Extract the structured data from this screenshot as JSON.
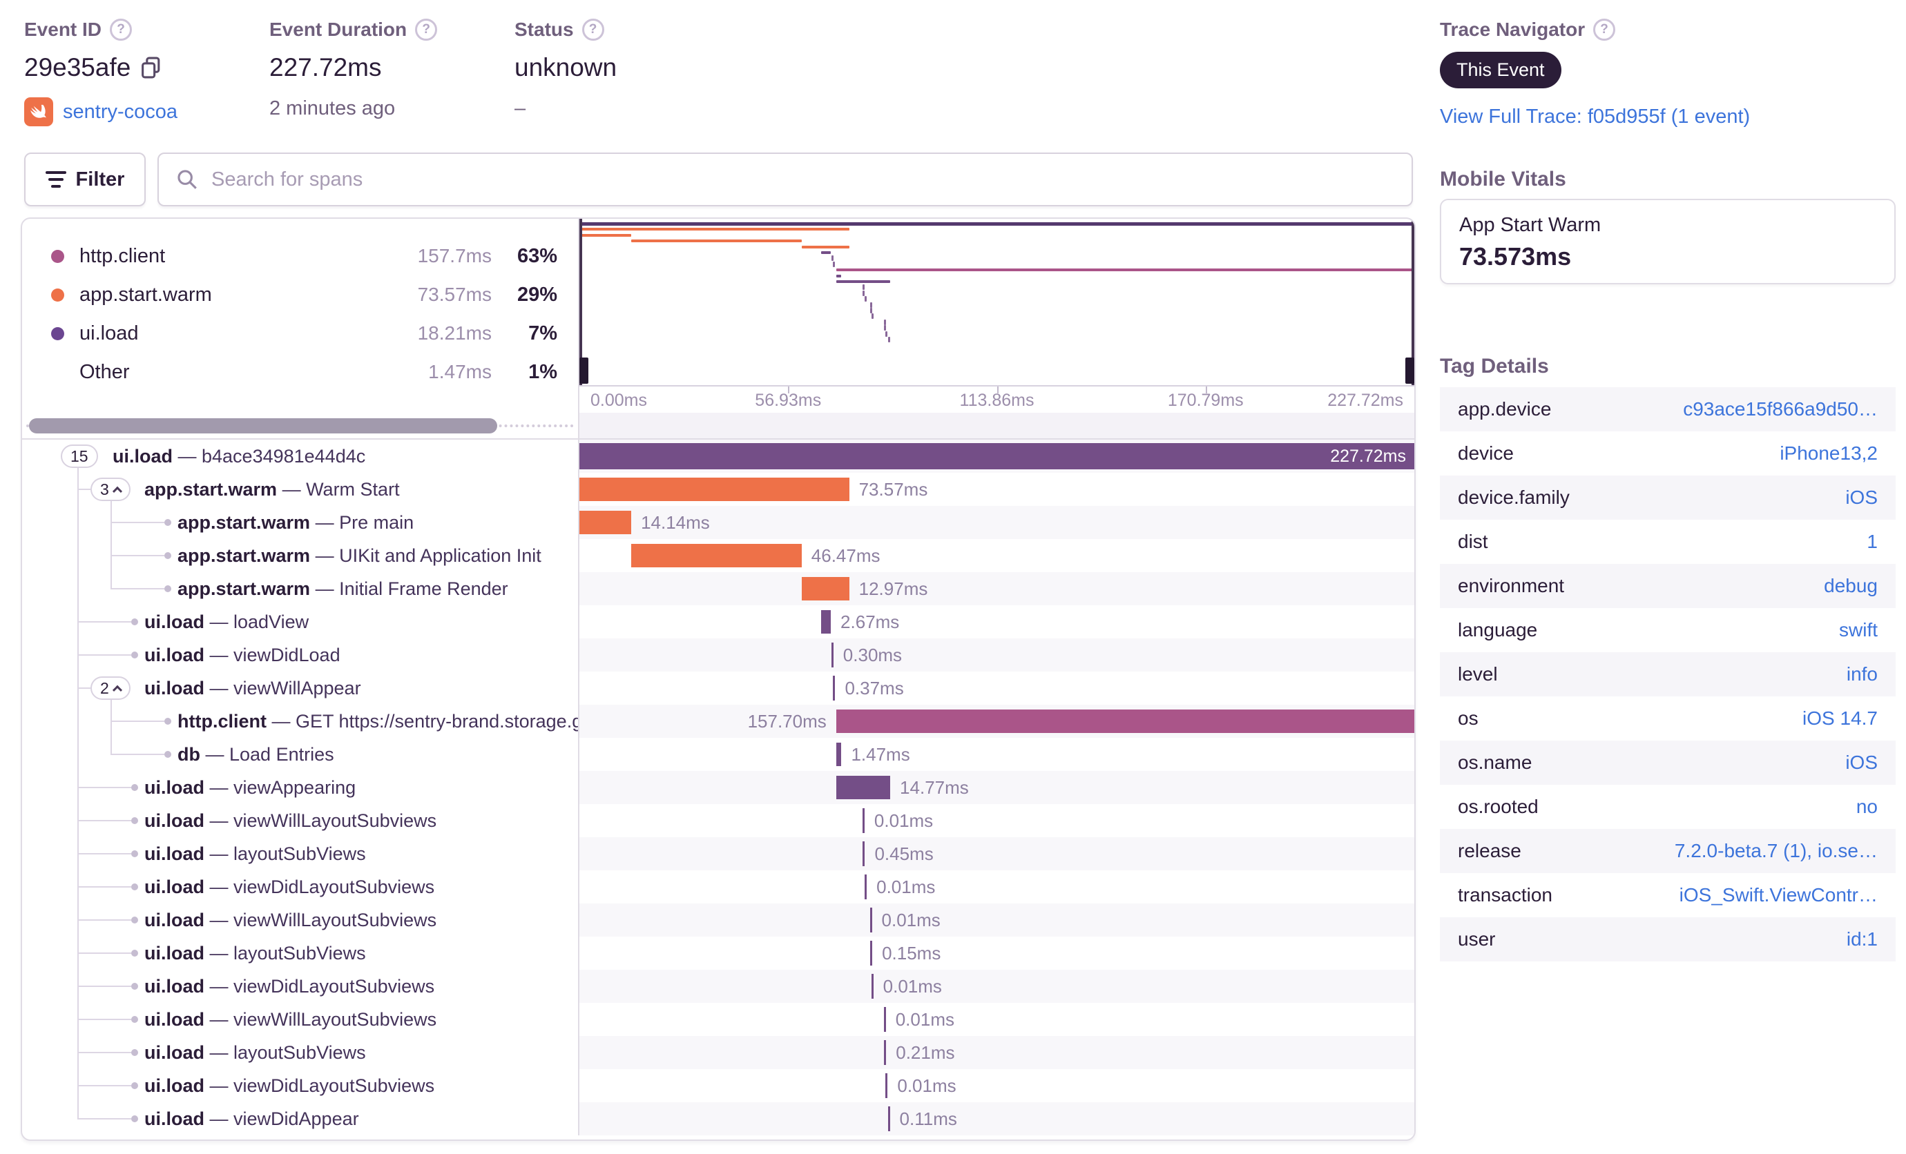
{
  "header": {
    "event_id": {
      "label": "Event ID",
      "value": "29e35afe",
      "project": "sentry-cocoa"
    },
    "event_duration": {
      "label": "Event Duration",
      "value": "227.72ms",
      "timeago": "2 minutes ago"
    },
    "status": {
      "label": "Status",
      "value": "unknown",
      "sub": "–"
    }
  },
  "trace_navigator": {
    "label": "Trace Navigator",
    "badge": "This Event",
    "link": "View Full Trace: f05d955f (1 event)"
  },
  "controls": {
    "filter_label": "Filter",
    "search_placeholder": "Search for spans"
  },
  "legend": {
    "items": [
      {
        "op": "http.client",
        "duration": "157.7ms",
        "percent": "63%",
        "color": "#aa5589"
      },
      {
        "op": "app.start.warm",
        "duration": "73.57ms",
        "percent": "29%",
        "color": "#ee7148"
      },
      {
        "op": "ui.load",
        "duration": "18.21ms",
        "percent": "7%",
        "color": "#6b4691"
      },
      {
        "op": "Other",
        "duration": "1.47ms",
        "percent": "1%",
        "color": null
      }
    ]
  },
  "minimap": {
    "axis_ticks": [
      "0.00ms",
      "56.93ms",
      "113.86ms",
      "170.79ms",
      "227.72ms"
    ]
  },
  "spans": {
    "total_ms": 227.72,
    "rows": [
      {
        "badge": "15",
        "expandable": false,
        "op": "ui.load",
        "desc": "b4ace34981e44d4c",
        "depth": 0,
        "start": 0,
        "dur": 227.72,
        "duration_label": "227.72ms",
        "label_pos": "inside"
      },
      {
        "badge": "3",
        "expandable": true,
        "op": "app.start.warm",
        "desc": "Warm Start",
        "depth": 1,
        "start": 0,
        "dur": 73.57,
        "duration_label": "73.57ms",
        "label_pos": "right"
      },
      {
        "op": "app.start.warm",
        "desc": "Pre main",
        "depth": 2,
        "start": 0,
        "dur": 14.14,
        "duration_label": "14.14ms",
        "label_pos": "right"
      },
      {
        "op": "app.start.warm",
        "desc": "UIKit and Application Init",
        "depth": 2,
        "start": 14.14,
        "dur": 46.47,
        "duration_label": "46.47ms",
        "label_pos": "right"
      },
      {
        "op": "app.start.warm",
        "desc": "Initial Frame Render",
        "depth": 2,
        "start": 60.61,
        "dur": 12.97,
        "duration_label": "12.97ms",
        "label_pos": "right"
      },
      {
        "op": "ui.load",
        "desc": "loadView",
        "depth": 1,
        "start": 65.9,
        "dur": 2.67,
        "duration_label": "2.67ms",
        "label_pos": "right"
      },
      {
        "op": "ui.load",
        "desc": "viewDidLoad",
        "depth": 1,
        "start": 68.9,
        "dur": 0.3,
        "duration_label": "0.30ms",
        "label_pos": "right"
      },
      {
        "badge": "2",
        "expandable": true,
        "op": "ui.load",
        "desc": "viewWillAppear",
        "depth": 1,
        "start": 69.4,
        "dur": 0.37,
        "duration_label": "0.37ms",
        "label_pos": "right"
      },
      {
        "op": "http.client",
        "desc": "GET https://sentry-brand.storage.googlea",
        "depth": 2,
        "start": 70.02,
        "dur": 157.7,
        "duration_label": "157.70ms",
        "label_pos": "left"
      },
      {
        "op": "db",
        "desc": "Load Entries",
        "depth": 2,
        "start": 70.0,
        "dur": 1.47,
        "duration_label": "1.47ms",
        "label_pos": "right"
      },
      {
        "op": "ui.load",
        "desc": "viewAppearing",
        "depth": 1,
        "start": 70.0,
        "dur": 14.77,
        "duration_label": "14.77ms",
        "label_pos": "right"
      },
      {
        "op": "ui.load",
        "desc": "viewWillLayoutSubviews",
        "depth": 1,
        "start": 77.4,
        "dur": 0.01,
        "duration_label": "0.01ms",
        "label_pos": "right"
      },
      {
        "op": "ui.load",
        "desc": "layoutSubViews",
        "depth": 1,
        "start": 77.5,
        "dur": 0.45,
        "duration_label": "0.45ms",
        "label_pos": "right"
      },
      {
        "op": "ui.load",
        "desc": "viewDidLayoutSubviews",
        "depth": 1,
        "start": 78.0,
        "dur": 0.01,
        "duration_label": "0.01ms",
        "label_pos": "right"
      },
      {
        "op": "ui.load",
        "desc": "viewWillLayoutSubviews",
        "depth": 1,
        "start": 79.4,
        "dur": 0.01,
        "duration_label": "0.01ms",
        "label_pos": "right"
      },
      {
        "op": "ui.load",
        "desc": "layoutSubViews",
        "depth": 1,
        "start": 79.5,
        "dur": 0.15,
        "duration_label": "0.15ms",
        "label_pos": "right"
      },
      {
        "op": "ui.load",
        "desc": "viewDidLayoutSubviews",
        "depth": 1,
        "start": 79.8,
        "dur": 0.01,
        "duration_label": "0.01ms",
        "label_pos": "right"
      },
      {
        "op": "ui.load",
        "desc": "viewWillLayoutSubviews",
        "depth": 1,
        "start": 83.2,
        "dur": 0.01,
        "duration_label": "0.01ms",
        "label_pos": "right"
      },
      {
        "op": "ui.load",
        "desc": "layoutSubViews",
        "depth": 1,
        "start": 83.3,
        "dur": 0.21,
        "duration_label": "0.21ms",
        "label_pos": "right"
      },
      {
        "op": "ui.load",
        "desc": "viewDidLayoutSubviews",
        "depth": 1,
        "start": 83.7,
        "dur": 0.01,
        "duration_label": "0.01ms",
        "label_pos": "right"
      },
      {
        "op": "ui.load",
        "desc": "viewDidAppear",
        "depth": 1,
        "start": 84.3,
        "dur": 0.11,
        "duration_label": "0.11ms",
        "label_pos": "right"
      }
    ]
  },
  "vitals": {
    "title": "Mobile Vitals",
    "card_title": "App Start Warm",
    "card_value": "73.573ms"
  },
  "tags": {
    "title": "Tag Details",
    "rows": [
      {
        "key": "app.device",
        "value": "c93ace15f866a9d50…"
      },
      {
        "key": "device",
        "value": "iPhone13,2"
      },
      {
        "key": "device.family",
        "value": "iOS"
      },
      {
        "key": "dist",
        "value": "1"
      },
      {
        "key": "environment",
        "value": "debug"
      },
      {
        "key": "language",
        "value": "swift"
      },
      {
        "key": "level",
        "value": "info"
      },
      {
        "key": "os",
        "value": "iOS 14.7"
      },
      {
        "key": "os.name",
        "value": "iOS"
      },
      {
        "key": "os.rooted",
        "value": "no"
      },
      {
        "key": "release",
        "value": "7.2.0-beta.7 (1), io.se…"
      },
      {
        "key": "transaction",
        "value": "iOS_Swift.ViewContr…"
      },
      {
        "key": "user",
        "value": "id:1"
      }
    ]
  },
  "colors": {
    "ui.load": "#744e87",
    "app.start.warm": "#ee7148",
    "http.client": "#aa5589",
    "db": "#744e87",
    "root_bar": "#744e87",
    "root_minimap": "#55396e",
    "accent_dark": "#2b1d38",
    "link_blue": "#3d74db"
  }
}
